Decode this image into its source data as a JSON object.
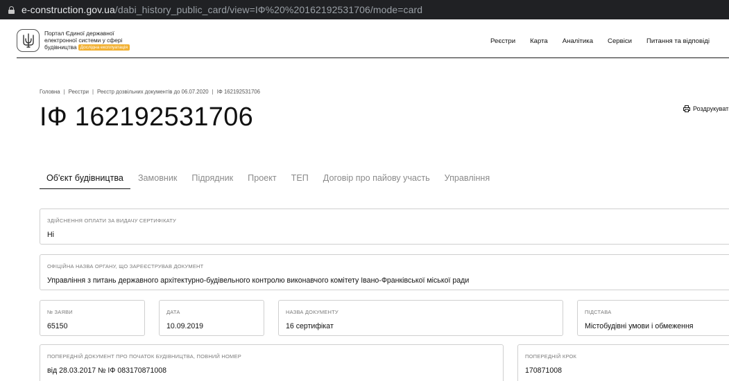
{
  "browser": {
    "url_host": "e-construction.gov.ua",
    "url_path": "/dabi_history_public_card/view=IФ%20%20162192531706/mode=card"
  },
  "header": {
    "portal_name_line1": "Портал Єдиної державної",
    "portal_name_line2": "електронної системи у сфері",
    "portal_name_line3": "будівництва",
    "beta_badge": "Дослідна експлуатація",
    "nav": [
      "Реєстри",
      "Карта",
      "Аналітика",
      "Сервіси",
      "Питання та відповіді"
    ]
  },
  "breadcrumb": [
    "Головна",
    "Реєстри",
    "Реєстр дозвільних документів до 06.07.2020",
    "IФ 162192531706"
  ],
  "page": {
    "title": "IФ 162192531706",
    "print_label": "Роздрукувати"
  },
  "tabs": [
    "Об'єкт будівництва",
    "Замовник",
    "Підрядник",
    "Проект",
    "ТЕП",
    "Договір про пайову участь",
    "Управління"
  ],
  "fields": {
    "payment": {
      "label": "Здійснення оплати за видачу сертифікату",
      "value": "Ні"
    },
    "authority": {
      "label": "Офіційна назва органу, що зареєстрував документ",
      "value": "Управління з питань державного архітектурно-будівельного контролю виконавчого комітету Івано-Франківської міської ради"
    },
    "app_number": {
      "label": "№ заяви",
      "value": "65150"
    },
    "date": {
      "label": "Дата",
      "value": "10.09.2019"
    },
    "doc_name": {
      "label": "Назва документу",
      "value": "16 сертифікат"
    },
    "basis": {
      "label": "Підстава",
      "value": "Містобудівні умови і обмеження"
    },
    "prev_doc": {
      "label": "Попередній документ про початок будівництва, повний номер",
      "value": "від 28.03.2017 № IФ 083170871008"
    },
    "prev_step": {
      "label": "Попередній крок",
      "value": "170871008"
    }
  }
}
